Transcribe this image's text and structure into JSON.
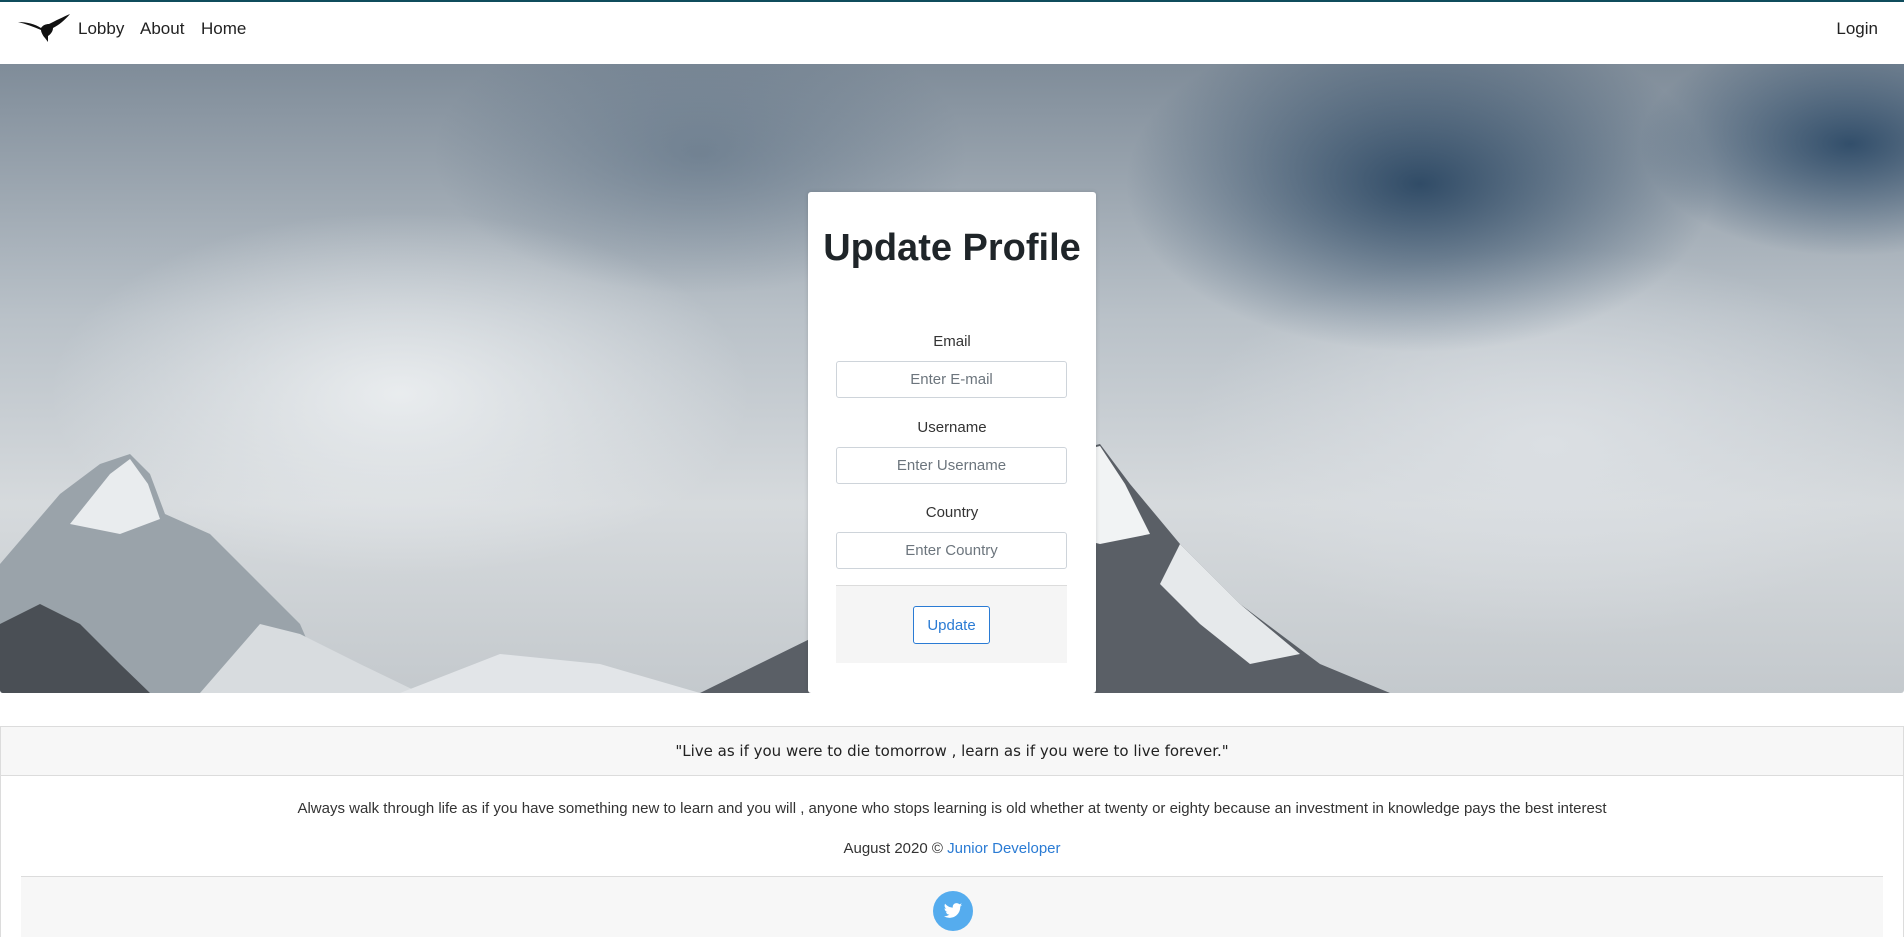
{
  "nav": {
    "logo_icon": "eagle-icon",
    "links": [
      "Lobby",
      "About",
      "Home"
    ],
    "login": "Login"
  },
  "form": {
    "title": "Update Profile",
    "email": {
      "label": "Email",
      "placeholder": "Enter E-mail",
      "value": ""
    },
    "username": {
      "label": "Username",
      "placeholder": "Enter Username",
      "value": ""
    },
    "country": {
      "label": "Country",
      "placeholder": "Enter Country",
      "value": ""
    },
    "submit_label": "Update"
  },
  "footer": {
    "quote": "\"Live as if you were to die tomorrow , learn as if you were to live forever.\"",
    "text": "Always walk through life as if you have something new to learn and you will , anyone who stops learning is old whether at twenty or eighty because an investment in knowledge pays the best interest",
    "copyright_prefix": "August 2020 ©",
    "copyright_link": "Junior Developer",
    "social_icon": "twitter-icon"
  },
  "colors": {
    "accent": "#2a7bd4",
    "twitter": "#55acee",
    "top_line": "#0f4c5c"
  }
}
